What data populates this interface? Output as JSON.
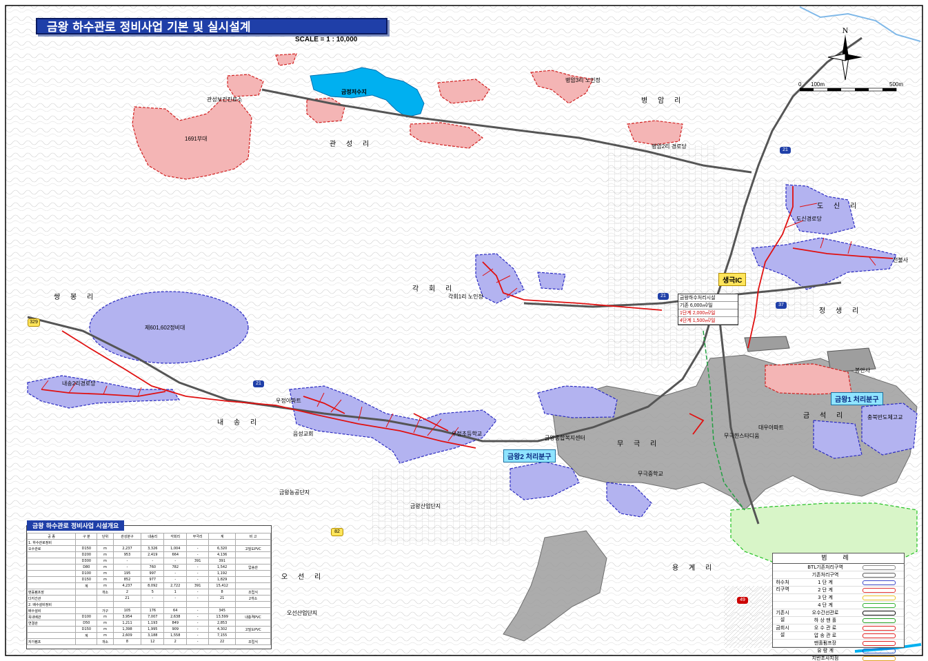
{
  "title": "금왕 하수관로 정비사업 기본 및 실시설계",
  "scale": "SCALE = 1 : 10,000",
  "north": "N",
  "scalebar": {
    "left": "0",
    "mid": "100m",
    "right": "500m"
  },
  "villages": [
    "병 암 리",
    "관 성 리",
    "도 신 리",
    "각 회 리",
    "쌍 봉 리",
    "정 생 리",
    "내 송 리",
    "금 석 리",
    "무 극 리",
    "오 선 리",
    "용 계 리"
  ],
  "places": {
    "reservoir": "금정저수지",
    "army": "1691부대",
    "military": "제601,602정비대",
    "clinic": "관성보건진료소",
    "byeongam3": "병암3리 노인정",
    "byeongam2": "병암2리 경로당",
    "dosin": "도신경로당",
    "temple": "천불사",
    "gakhoe": "각회1리 노인정",
    "naesong": "내송2리경로당",
    "ujeong_apt": "우정아파트",
    "eumseong_church": "음성교회",
    "ujeong_elem": "우정초등학교",
    "geumwang_center": "금왕종합복지센터",
    "mugeuk_middle": "무극중학교",
    "mugeuk_hs": "무극한스타디움",
    "industrial": "금왕산업단지",
    "agri": "금왕농공단지",
    "osun": "오선산업단지",
    "chunghyeon": "충북반도체고교",
    "bongani": "봉안사",
    "daeu_apt": "대우아파트"
  },
  "zone_tags": {
    "zone1": "금왕1 처리분구",
    "zone2": "금왕2 처리분구",
    "interchange": "생극IC"
  },
  "roads": {
    "r21a": "21",
    "r21b": "21",
    "r21c": "21",
    "r37": "37",
    "r329": "329",
    "r82": "82",
    "r49": "49"
  },
  "plant": {
    "name": "금왕하수처리시설",
    "rows": [
      "기존 6,000㎥/일",
      "1단계 2,000㎥/일",
      "4단계 1,500㎥/일"
    ]
  },
  "summary": {
    "title": "금왕 하수관로 정비사업 시설개요",
    "header": [
      "공 종",
      "구 분",
      "단위",
      "관성분구",
      "내송리",
      "각회리",
      "무극리",
      "계",
      "비 고"
    ],
    "rows": [
      [
        "1. 하수관로정비",
        "",
        "",
        "",
        "",
        "",
        "",
        "",
        ""
      ],
      [
        "오수관로",
        "D150",
        "m",
        "2,237",
        "3,326",
        "1,004",
        "-",
        "6,320",
        "고밀도PVC"
      ],
      [
        "",
        "D200",
        "m",
        "953",
        "2,419",
        "664",
        "-",
        "4,136",
        ""
      ],
      [
        "",
        "D300",
        "m",
        "-",
        "-",
        "-",
        "391",
        "391",
        ""
      ],
      [
        "",
        "D80",
        "m",
        "-",
        "760",
        "782",
        "-",
        "1,542",
        "압송관"
      ],
      [
        "",
        "D100",
        "m",
        "195",
        "997",
        "-",
        "-",
        "1,192",
        ""
      ],
      [
        "",
        "D150",
        "m",
        "852",
        "977",
        "-",
        "-",
        "1,829",
        ""
      ],
      [
        "",
        "계",
        "m",
        "4,237",
        "8,092",
        "2,722",
        "391",
        "15,412",
        ""
      ],
      [
        "맨홀펌프장",
        "",
        "개소",
        "2",
        "5",
        "1",
        "-",
        "8",
        "조립식"
      ],
      [
        "다지간관",
        "",
        "",
        "21",
        "-",
        "-",
        "-",
        "21",
        "2개소"
      ],
      [
        "2. 배수설비정비",
        "",
        "",
        "",
        "",
        "",
        "",
        "",
        ""
      ],
      [
        "배수설비",
        "",
        "가구",
        "105",
        "176",
        "64",
        "-",
        "345",
        ""
      ],
      [
        "옥내배관",
        "D100",
        "m",
        "3,954",
        "7,007",
        "2,638",
        "-",
        "13,599",
        "내충격PVC"
      ],
      [
        "연결관",
        "D50",
        "m",
        "1,211",
        "1,193",
        "849",
        "-",
        "2,853",
        ""
      ],
      [
        "",
        "D150",
        "m",
        "1,398",
        "1,995",
        "909",
        "-",
        "4,302",
        "고밀도PVC"
      ],
      [
        "",
        "계",
        "m",
        "2,609",
        "3,188",
        "1,558",
        "-",
        "7,155",
        ""
      ],
      [
        "자가펌프",
        "",
        "개소",
        "8",
        "12",
        "2",
        "-",
        "22",
        "조립식"
      ]
    ]
  },
  "legend": {
    "title": "범 례",
    "rows": [
      {
        "group": "",
        "label": "BTL기존처리구역",
        "color": "#888888"
      },
      {
        "group": "",
        "label": "기존처리구역",
        "color": "#555555"
      },
      {
        "group": "하수처리구역",
        "label": "1 단 계",
        "color": "#3a46c8"
      },
      {
        "group": "",
        "label": "2 단 계",
        "color": "#e03030"
      },
      {
        "group": "",
        "label": "3 단 계",
        "color": "#e8c020"
      },
      {
        "group": "",
        "label": "4 단 계",
        "color": "#30b030"
      },
      {
        "group": "기존시설",
        "label": "오수간선관로",
        "color": "#000000"
      },
      {
        "group": "",
        "label": "하 상 맨 홀",
        "color": "#20a020"
      },
      {
        "group": "금회시설",
        "label": "오 수 관 로",
        "color": "#e02020"
      },
      {
        "group": "",
        "label": "압 송 관 로",
        "color": "#e02020"
      },
      {
        "group": "",
        "label": "맨홀펌프장",
        "color": "#e02020"
      },
      {
        "group": "",
        "label": "유 량 계",
        "color": "#2050c0"
      },
      {
        "group": "",
        "label": "지반조사지점",
        "color": "#e0a020"
      }
    ]
  }
}
